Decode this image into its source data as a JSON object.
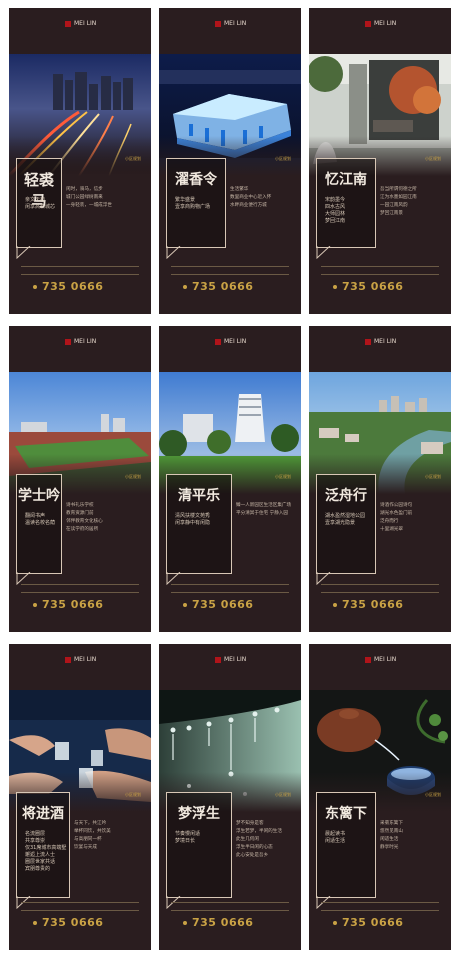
{
  "cards": [
    {
      "title": "轻裘马",
      "sub": [
        "亲文天苑",
        "闲享高新城芯"
      ],
      "body": [
        "闲时，骑马，信步",
        "城门公园绿树南来",
        "一身轻装，一城成浮世"
      ]
    },
    {
      "title": "濯香令",
      "sub": [
        "繁华盛景",
        "壹享商购物广场"
      ],
      "body": [
        "生活繁华",
        "数里商业中心近入怀",
        "水畔商业便行方城"
      ]
    },
    {
      "title": "忆江南",
      "sub": [
        "宋韵墨今",
        "四水古风",
        "大师园林",
        "梦回江南"
      ],
      "body": [
        "吾当所谓何德之所",
        "江为水墨如园江南",
        "一园江南风韵",
        "梦回江南景"
      ]
    },
    {
      "title": "学士吟",
      "sub": [
        "翻阅书声",
        "温读名校名荫"
      ],
      "body": [
        "诗书礼乐学校",
        "教育资源门前",
        "邻伴教育文化核心",
        "在读学府的居所"
      ]
    },
    {
      "title": "清平乐",
      "sub": [
        "清风扶楼文苑秀",
        "闲享静中有闲隐"
      ],
      "body": [
        "臻一人新园区生活区集广场",
        "平分清冥于住宅 宁静入园"
      ]
    },
    {
      "title": "泛舟行",
      "sub": [
        "湖水盈然湿地公园",
        "壹享湖光隐景"
      ],
      "body": [
        "诗酒作公园诗句",
        "湖光水色盈门前",
        "泛舟而行",
        "十里湖光翠"
      ]
    },
    {
      "title": "将进酒",
      "sub": [
        "名流圈层",
        "共享尊崇",
        "仅31席城市高端墅",
        "邂逅上流人士",
        "圈层世家共话",
        "宾朋尊贵的"
      ],
      "body": [
        "与天下，共江吟",
        "举杯同饮，共饮美",
        "与高朋同一杯",
        "饮宴与天成"
      ]
    },
    {
      "title": "梦浮生",
      "sub": [
        "节奏慢闲适",
        "梦境日长"
      ],
      "body": [
        "梦不知身是客",
        "浮生若梦，半闲的生活",
        "此生几何闲",
        "浮生半日闲的心态",
        "此心安处是吾乡"
      ]
    },
    {
      "title": "东篱下",
      "sub": [
        "晨起读书",
        "闲适生活"
      ],
      "body": [
        "采菊东篱下",
        "悠然见南山",
        "闲适生活",
        "静享时光"
      ]
    }
  ],
  "brand": "MEI LIN",
  "phone": "735 0666",
  "tag": "小区规划"
}
